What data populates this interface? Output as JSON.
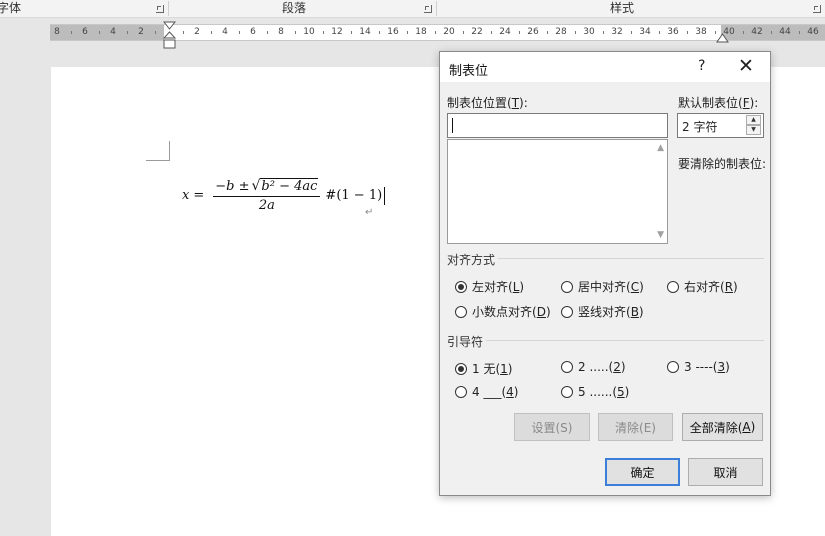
{
  "ribbon": {
    "font_group": "字体",
    "paragraph_group": "段落",
    "styles_group": "样式"
  },
  "ruler": {
    "left_labels": [
      "8",
      "6",
      "4",
      "2"
    ],
    "right_labels": [
      "2",
      "4",
      "6",
      "8",
      "10",
      "12",
      "14",
      "16",
      "18",
      "20",
      "22",
      "24",
      "26",
      "28",
      "30",
      "32",
      "34",
      "36",
      "38",
      "40",
      "42",
      "44",
      "46"
    ]
  },
  "document": {
    "formula": {
      "x": "x",
      "equals": "=",
      "num_prefix": "−b ±",
      "radicand": "b² − 4ac",
      "denominator": "2a",
      "suffix": "#(1 − 1)"
    },
    "paragraph_mark": "↵"
  },
  "dialog": {
    "title": "制表位",
    "help": "?",
    "close": "✕",
    "tab_position_label": "制表位位置(",
    "tab_position_key": "T",
    "tab_position_value": "",
    "default_stops_label": "默认制表位(",
    "default_stops_key": "F",
    "default_stops_value": "2 字符",
    "to_clear_label": "要清除的制表位:",
    "alignment_section": "对齐方式",
    "alignment": {
      "left": {
        "label": "左对齐(",
        "key": "L"
      },
      "center": {
        "label": "居中对齐(",
        "key": "C"
      },
      "right": {
        "label": "右对齐(",
        "key": "R"
      },
      "decimal": {
        "label": "小数点对齐(",
        "key": "D"
      },
      "bar": {
        "label": "竖线对齐(",
        "key": "B"
      },
      "selected": "left"
    },
    "leader_section": "引导符",
    "leader": {
      "l1": {
        "label": "1 无(",
        "key": "1"
      },
      "l2": {
        "label": "2 .....(",
        "key": "2"
      },
      "l3": {
        "label": "3 ----(",
        "key": "3"
      },
      "l4": {
        "label": "4 ___(",
        "key": "4"
      },
      "l5": {
        "label": "5 ......(",
        "key": "5"
      },
      "selected": "l1"
    },
    "buttons": {
      "set": "设置(S)",
      "clear": "清除(E)",
      "clear_all": "全部清除(",
      "clear_all_key": "A",
      "ok": "确定",
      "cancel": "取消"
    },
    "close_paren": ")",
    "colon_paren": "):"
  }
}
